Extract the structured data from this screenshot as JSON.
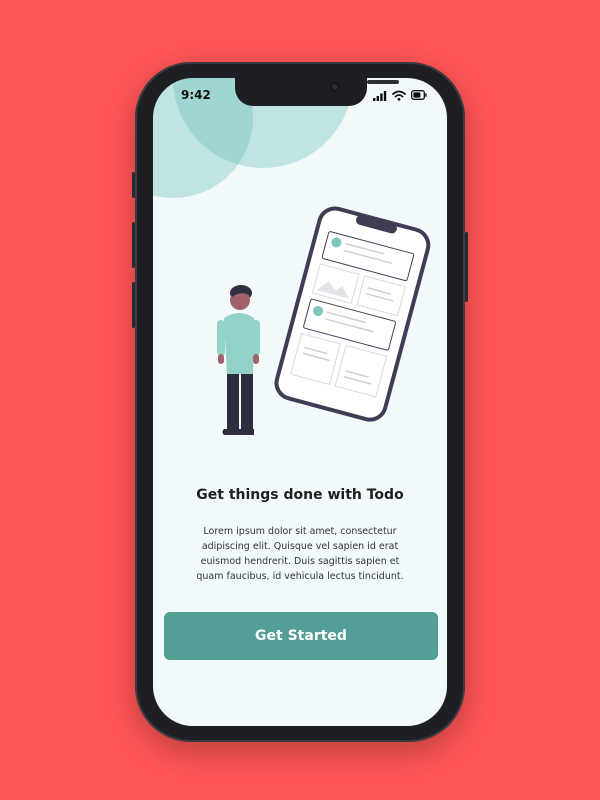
{
  "status_bar": {
    "time": "9:42"
  },
  "onboarding": {
    "title": "Get things done with Todo",
    "description": "Lorem ipsum dolor sit amet, consectetur adipiscing elit. Quisque vel sapien id erat euismod hendrerit. Duis sagittis sapien et quam faucibus, id vehicula lectus tincidunt.",
    "cta_label": "Get Started"
  },
  "colors": {
    "background": "#FF5555",
    "screen": "#F2F9FB",
    "accent": "#539E96",
    "blob": "#A8D8D2"
  },
  "icons": [
    "cellular-signal-icon",
    "wifi-icon",
    "battery-icon"
  ]
}
